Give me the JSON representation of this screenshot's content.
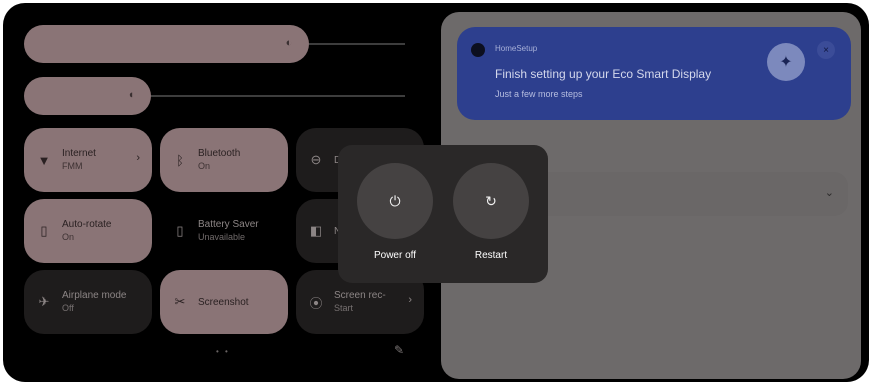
{
  "sliders": {
    "brightness": {
      "level": 0.74,
      "icon": "brightness-icon"
    },
    "volume": {
      "level": 0.32,
      "icon": "volume-icon"
    }
  },
  "tiles": [
    {
      "title": "Internet",
      "subtitle": "FMM",
      "icon": "wifi-icon",
      "state": "on",
      "chevron": true
    },
    {
      "title": "Bluetooth",
      "subtitle": "On",
      "icon": "bluetooth-icon",
      "state": "on",
      "chevron": false
    },
    {
      "title": "Do",
      "subtitle": "",
      "icon": "dnd-icon",
      "state": "off",
      "chevron": false
    },
    {
      "title": "Auto-rotate",
      "subtitle": "On",
      "icon": "rotate-icon",
      "state": "on",
      "chevron": false
    },
    {
      "title": "Battery Saver",
      "subtitle": "Unavailable",
      "icon": "battery-icon",
      "state": "off",
      "chevron": false
    },
    {
      "title": "N",
      "subtitle": "",
      "icon": "night-icon",
      "state": "off",
      "chevron": false
    },
    {
      "title": "Airplane mode",
      "subtitle": "Off",
      "icon": "airplane-icon",
      "state": "off",
      "chevron": false
    },
    {
      "title": "Screenshot",
      "subtitle": "",
      "icon": "screenshot-icon",
      "state": "on",
      "chevron": false
    },
    {
      "title": "Screen rec-",
      "subtitle": "Start",
      "icon": "screen-record-icon",
      "state": "off",
      "chevron": true
    }
  ],
  "pager": "• •",
  "notification": {
    "app": "HomeSetup",
    "title": "Finish setting up your Eco Smart Display",
    "subtitle": "Just a few more steps"
  },
  "power_menu": {
    "power_off_label": "Power off",
    "restart_label": "Restart"
  }
}
